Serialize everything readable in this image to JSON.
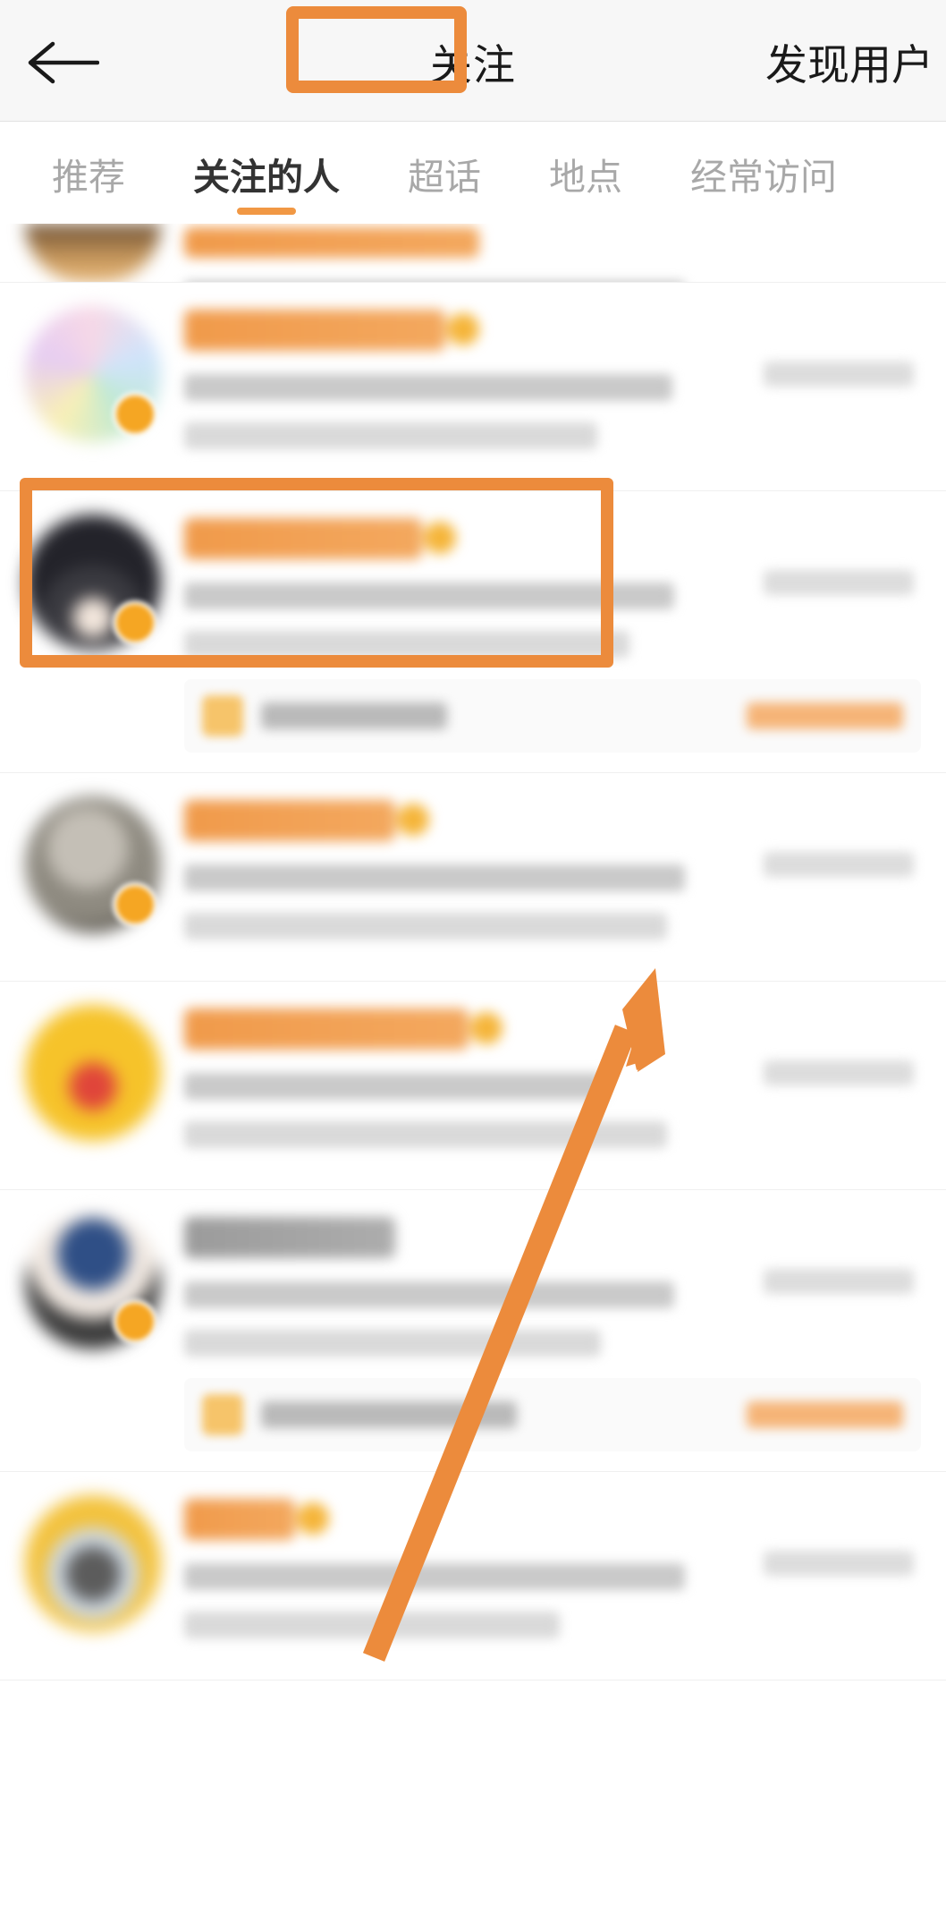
{
  "header": {
    "back_icon": "back-arrow-icon",
    "title": "关注",
    "action_label": "发现用户"
  },
  "tabs": [
    {
      "label": "推荐",
      "active": false
    },
    {
      "label": "关注的人",
      "active": true
    },
    {
      "label": "超话",
      "active": false
    },
    {
      "label": "地点",
      "active": false
    },
    {
      "label": "经常访问",
      "active": false
    }
  ],
  "annotations": {
    "accent_color": "#ec8b3c",
    "title_highlight_box": "关注",
    "item_highlight_box": "list-item-2",
    "arrow": "points-up-right-to-highlighted-list-item"
  },
  "colors": {
    "accent": "#ec8b3c",
    "tab_active": "#333333",
    "tab_inactive": "#a8a8a8",
    "header_bg": "#f7f7f7",
    "username": "#f0923a"
  },
  "list": {
    "note": "user list content is blurred for privacy",
    "items": [
      {
        "name": "",
        "desc": "",
        "time": "",
        "partial": true,
        "has_subcard": false
      },
      {
        "name": "",
        "desc": "",
        "time": "",
        "partial": false,
        "has_subcard": false
      },
      {
        "name": "",
        "desc": "",
        "time": "",
        "partial": false,
        "has_subcard": true
      },
      {
        "name": "",
        "desc": "",
        "time": "",
        "partial": false,
        "has_subcard": false
      },
      {
        "name": "",
        "desc": "",
        "time": "",
        "partial": false,
        "has_subcard": false
      },
      {
        "name": "",
        "desc": "",
        "time": "",
        "partial": false,
        "has_subcard": true
      },
      {
        "name": "",
        "desc": "",
        "time": "",
        "partial": false,
        "has_subcard": false
      }
    ]
  }
}
